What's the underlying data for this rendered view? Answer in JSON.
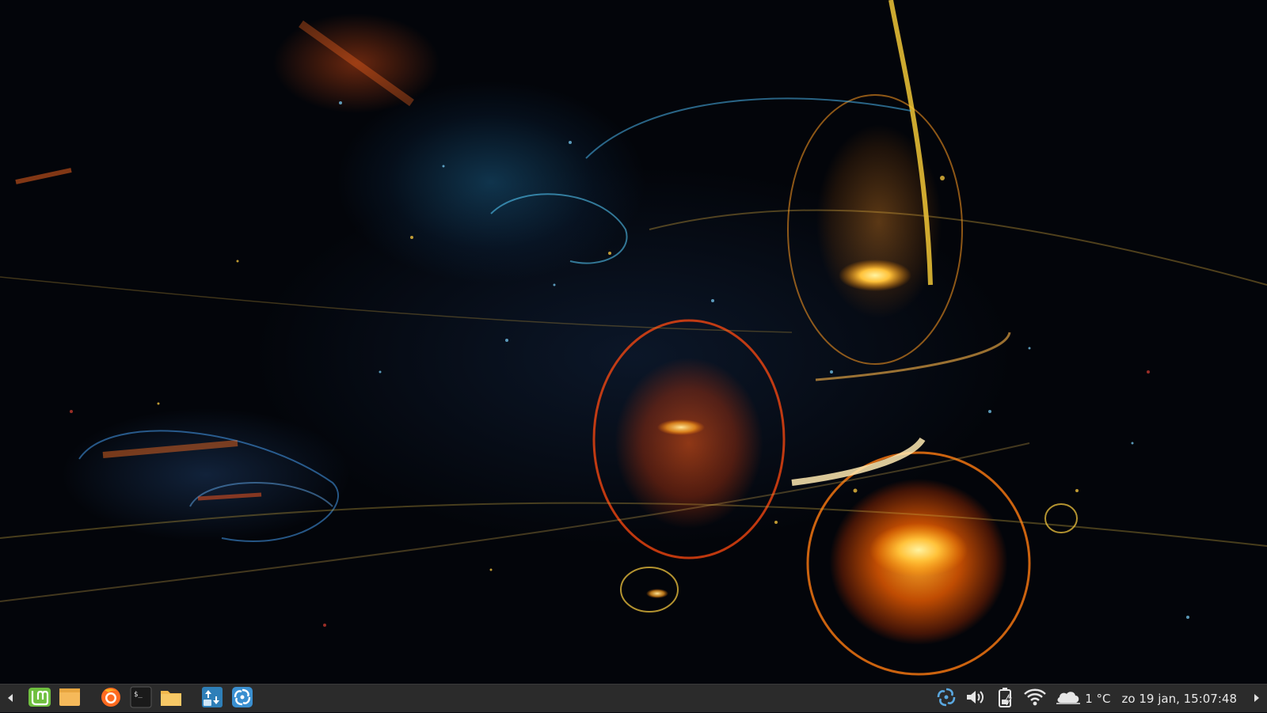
{
  "desktop": {
    "wallpaper": "abstract-fractal-orbs-wallpaper"
  },
  "panel": {
    "left_arrow_icon": "triangle-left-icon",
    "right_arrow_icon": "triangle-right-icon",
    "launchers": [
      {
        "name": "mint-menu",
        "icon": "linux-mint-logo-icon",
        "color": "#6fbf3f"
      },
      {
        "name": "files",
        "icon": "folder-icon",
        "color": "#f5b95a"
      },
      {
        "name": "firefox",
        "icon": "firefox-icon",
        "color": "#ff6a1f"
      },
      {
        "name": "terminal",
        "icon": "terminal-icon",
        "color": "#1a1a1a"
      },
      {
        "name": "file-manager",
        "icon": "folder-icon",
        "color": "#f2b94d"
      },
      {
        "name": "update-manager",
        "icon": "update-manager-icon",
        "color": "#2e7fb8"
      },
      {
        "name": "app-launcher",
        "icon": "swirl-icon",
        "color": "#3a8fd0"
      }
    ],
    "tray": {
      "weather_temp": "1 °C",
      "clock": "zo 19 jan, 15:07:48"
    }
  }
}
